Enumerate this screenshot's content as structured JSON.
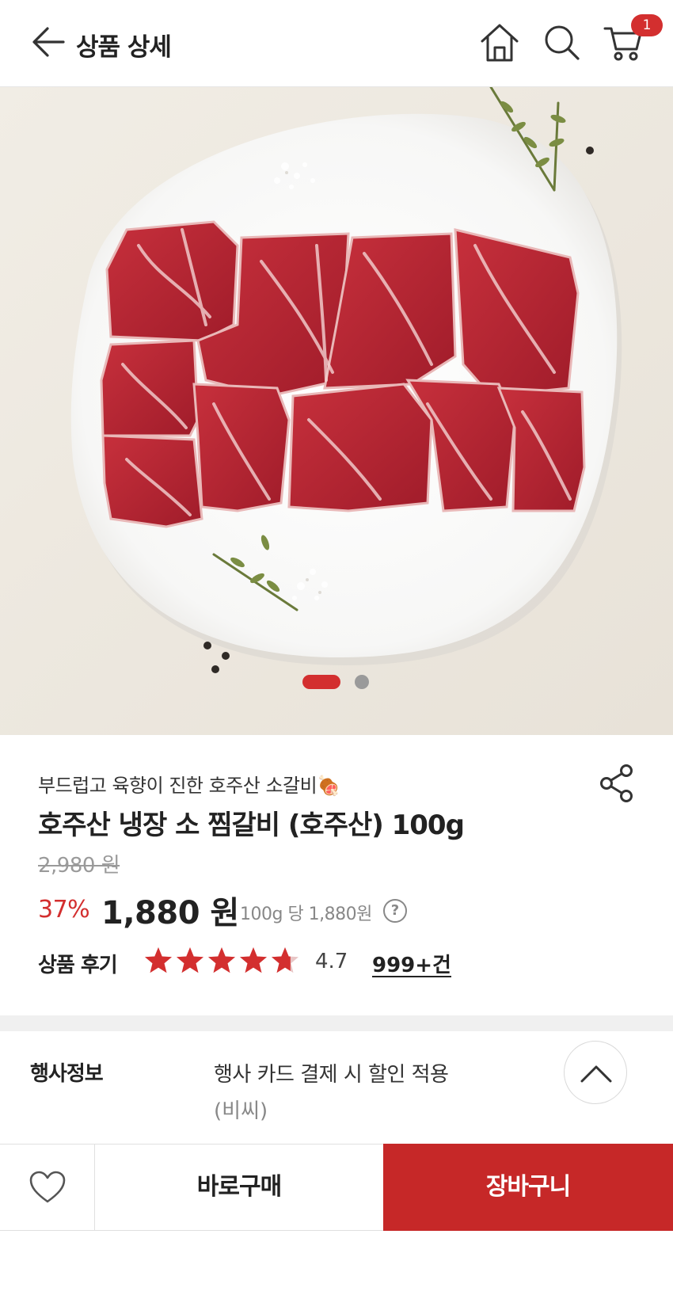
{
  "header": {
    "title": "상품 상세",
    "cart_count": "1"
  },
  "product": {
    "subtitle": "부드럽고 육향이 진한 호주산 소갈비🍖",
    "name": "호주산 냉장 소 찜갈비 (호주산) 100g",
    "original_price": "2,980 원",
    "discount_rate": "37%",
    "sale_price": "1,880 원",
    "unit_price": "100g 당 1,880원",
    "help_symbol": "?"
  },
  "reviews": {
    "label": "상품 후기",
    "rating": 4.7,
    "rating_text": "4.7",
    "count": "999+건"
  },
  "event": {
    "label": "행사정보",
    "text": "행사 카드 결제 시 할인 적용",
    "sub_text": "(비씨)"
  },
  "carousel": {
    "total_slides": 2,
    "active_index": 0
  },
  "actions": {
    "buy_now": "바로구매",
    "add_to_cart": "장바구니"
  },
  "colors": {
    "accent": "#d32f2f",
    "cart_button": "#c62828",
    "background_image": "#efebe3"
  },
  "icons": [
    "back-arrow-icon",
    "home-icon",
    "search-icon",
    "cart-icon",
    "share-icon",
    "star-icon",
    "help-icon",
    "chevron-up-icon",
    "heart-icon"
  ]
}
